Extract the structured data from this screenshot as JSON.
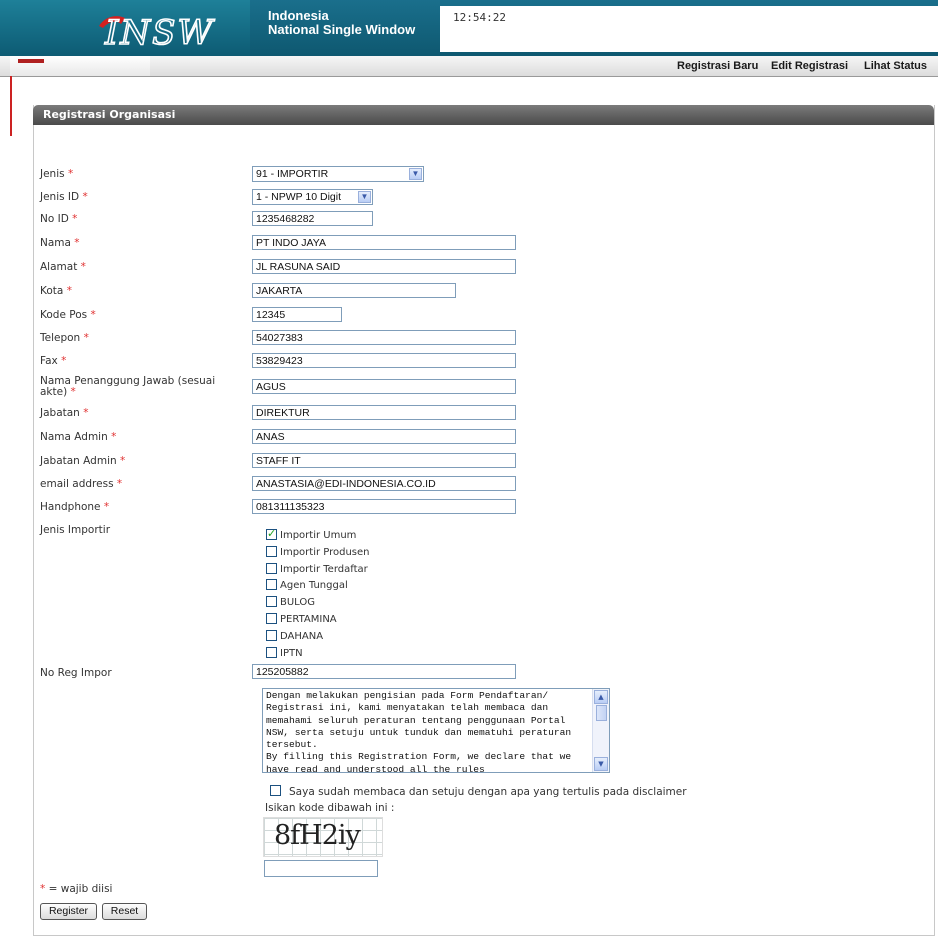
{
  "header": {
    "brand_line1": "Indonesia",
    "brand_line2": "National Single Window",
    "clock": "12:54:22"
  },
  "nav": {
    "registrasi_baru": "Registrasi Baru",
    "edit_registrasi": "Edit Registrasi",
    "lihat_status": "Lihat Status"
  },
  "panel": {
    "title": "Registrasi Organisasi"
  },
  "form": {
    "jenis": {
      "label": "Jenis",
      "value": "91 - IMPORTIR"
    },
    "jenis_id": {
      "label": "Jenis ID",
      "value": "1 - NPWP 10 Digit"
    },
    "no_id": {
      "label": "No ID",
      "value": "1235468282"
    },
    "nama": {
      "label": "Nama",
      "value": "PT INDO JAYA"
    },
    "alamat": {
      "label": "Alamat",
      "value": "JL RASUNA SAID"
    },
    "kota": {
      "label": "Kota",
      "value": "JAKARTA"
    },
    "kode_pos": {
      "label": "Kode Pos",
      "value": "12345"
    },
    "telepon": {
      "label": "Telepon",
      "value": "54027383"
    },
    "fax": {
      "label": "Fax",
      "value": "53829423"
    },
    "penanggung_jawab": {
      "label_line1": "Nama Penanggung Jawab (sesuai",
      "label_line2": "akte)",
      "value": "AGUS"
    },
    "jabatan": {
      "label": "Jabatan",
      "value": "DIREKTUR"
    },
    "nama_admin": {
      "label": "Nama Admin",
      "value": "ANAS"
    },
    "jabatan_admin": {
      "label": "Jabatan Admin",
      "value": "STAFF IT"
    },
    "email": {
      "label": "email address",
      "value": "ANASTASIA@EDI-INDONESIA.CO.ID"
    },
    "handphone": {
      "label": "Handphone",
      "value": "081311135323"
    },
    "jenis_importir": {
      "label": "Jenis Importir",
      "options": [
        {
          "label": "Importir Umum",
          "checked": true
        },
        {
          "label": "Importir Produsen",
          "checked": false
        },
        {
          "label": "Importir Terdaftar",
          "checked": false
        },
        {
          "label": "Agen Tunggal",
          "checked": false
        },
        {
          "label": "BULOG",
          "checked": false
        },
        {
          "label": "PERTAMINA",
          "checked": false
        },
        {
          "label": "DAHANA",
          "checked": false
        },
        {
          "label": "IPTN",
          "checked": false
        }
      ]
    },
    "no_reg_impor": {
      "label": "No Reg Impor",
      "value": "125205882"
    },
    "disclaimer_text": "Dengan melakukan pengisian pada Form Pendaftaran/ Registrasi ini, kami menyatakan telah membaca dan memahami seluruh peraturan tentang penggunaan Portal NSW, serta setuju untuk tunduk dan mematuhi peraturan tersebut.\nBy filling this Registration Form, we declare that we have read and understood all the rules",
    "agree": {
      "label": "Saya sudah membaca dan setuju dengan apa yang tertulis pada disclaimer",
      "checked": false
    },
    "captcha_label": "Isikan kode dibawah ini :",
    "captcha_code": "8fH2iy",
    "captcha_input": "",
    "required_star": "*",
    "required_note": "= wajib diisi",
    "register_label": "Register",
    "reset_label": "Reset"
  },
  "colors": {
    "header": "#0f5c74",
    "required": "#e03030",
    "panel_head": "#5a5a5a"
  }
}
